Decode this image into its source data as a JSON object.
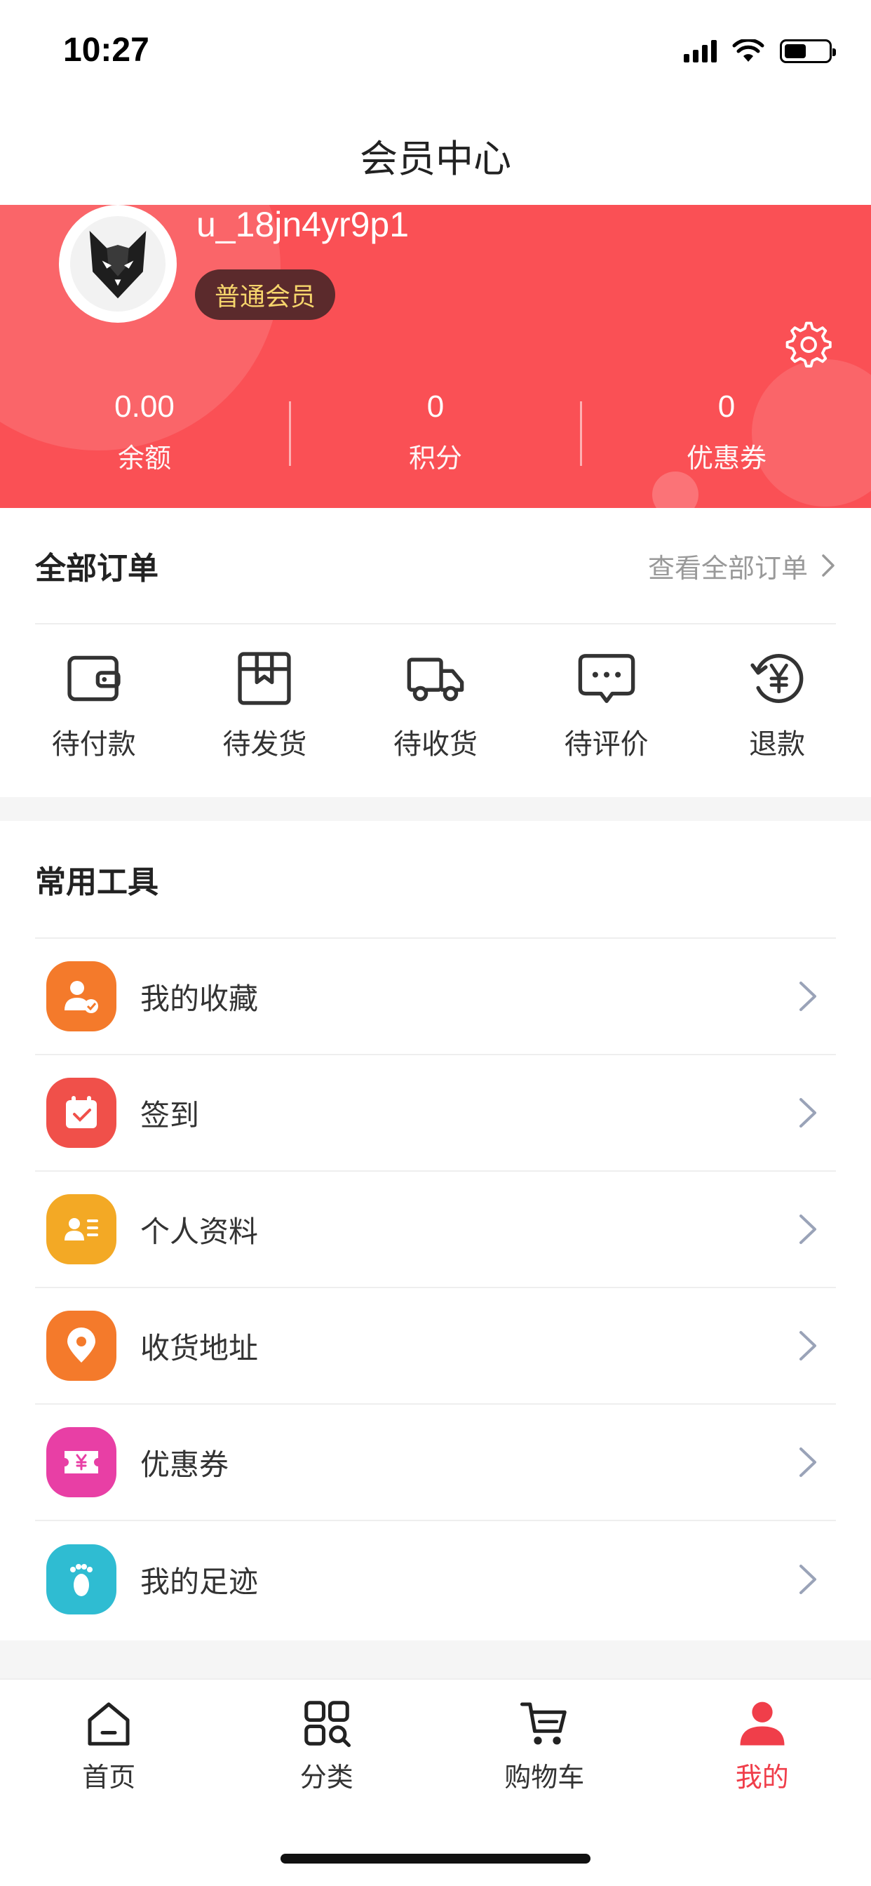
{
  "status": {
    "time": "10:27"
  },
  "header": {
    "title": "会员中心"
  },
  "profile": {
    "username": "u_18jn4yr9p1",
    "member_level": "普通会员",
    "stats": [
      {
        "value": "0.00",
        "label": "余额"
      },
      {
        "value": "0",
        "label": "积分"
      },
      {
        "value": "0",
        "label": "优惠券"
      }
    ]
  },
  "orders": {
    "title": "全部订单",
    "view_all": "查看全部订单",
    "items": [
      {
        "label": "待付款",
        "icon": "wallet-icon"
      },
      {
        "label": "待发货",
        "icon": "package-icon"
      },
      {
        "label": "待收货",
        "icon": "truck-icon"
      },
      {
        "label": "待评价",
        "icon": "comment-icon"
      },
      {
        "label": "退款",
        "icon": "refund-icon"
      }
    ]
  },
  "tools": {
    "title": "常用工具",
    "items": [
      {
        "label": "我的收藏",
        "icon": "favorites-icon",
        "color": "#f47a2b"
      },
      {
        "label": "签到",
        "icon": "checkin-icon",
        "color": "#f0504a"
      },
      {
        "label": "个人资料",
        "icon": "profile-card-icon",
        "color": "#f3a925"
      },
      {
        "label": "收货地址",
        "icon": "location-icon",
        "color": "#f47a2b"
      },
      {
        "label": "优惠券",
        "icon": "coupon-icon",
        "color": "#e83fa5"
      },
      {
        "label": "我的足迹",
        "icon": "footprint-icon",
        "color": "#2fbcd2"
      }
    ]
  },
  "tabbar": {
    "tabs": [
      {
        "label": "首页",
        "icon": "home-icon"
      },
      {
        "label": "分类",
        "icon": "category-icon"
      },
      {
        "label": "购物车",
        "icon": "cart-icon"
      },
      {
        "label": "我的",
        "icon": "user-icon",
        "active": true
      }
    ]
  },
  "colors": {
    "brand": "#fa5055",
    "active_tab": "#f03e4a",
    "badge_text": "#f6d56c"
  }
}
